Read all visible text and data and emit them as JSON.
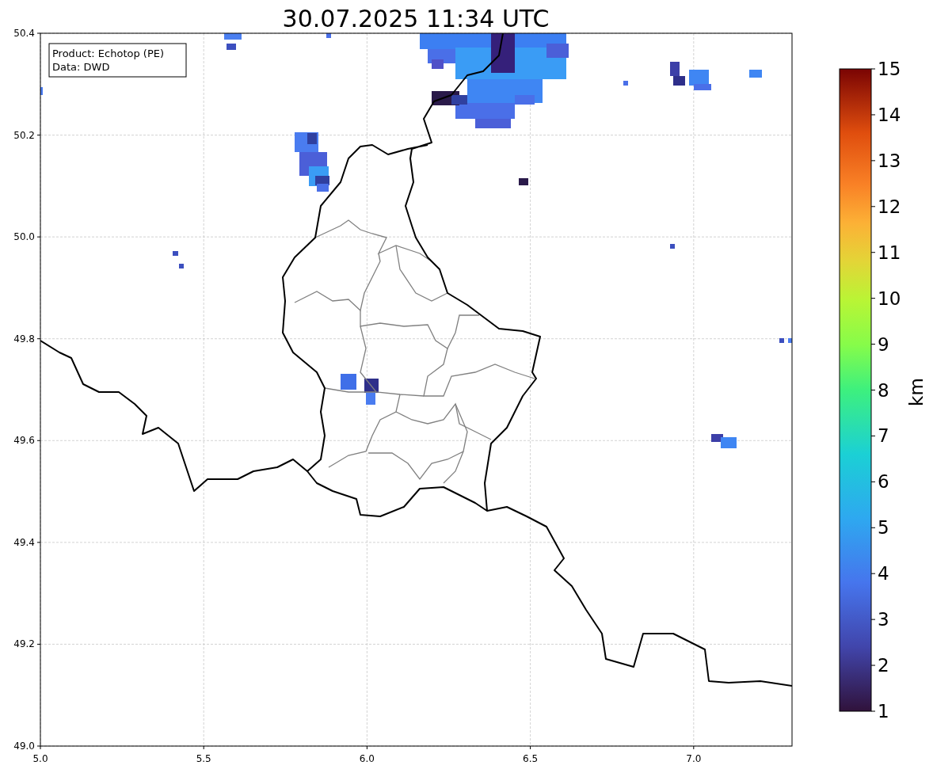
{
  "title": "30.07.2025 11:34 UTC",
  "info_box": {
    "lines": [
      "Product: Echotop (PE)",
      "Data: DWD"
    ]
  },
  "x_axis": {
    "ticks": [
      "5.0",
      "5.5",
      "6.0",
      "6.5",
      "7.0"
    ]
  },
  "y_axis": {
    "ticks": [
      "50.4",
      "50.2",
      "50.0",
      "49.8",
      "49.6",
      "49.4",
      "49.2",
      "49.0"
    ]
  },
  "colorbar": {
    "label": "km",
    "ticks": [
      "15",
      "14",
      "13",
      "12",
      "11",
      "10",
      "9",
      "8",
      "7",
      "6",
      "5",
      "4",
      "3",
      "2",
      "1"
    ]
  }
}
